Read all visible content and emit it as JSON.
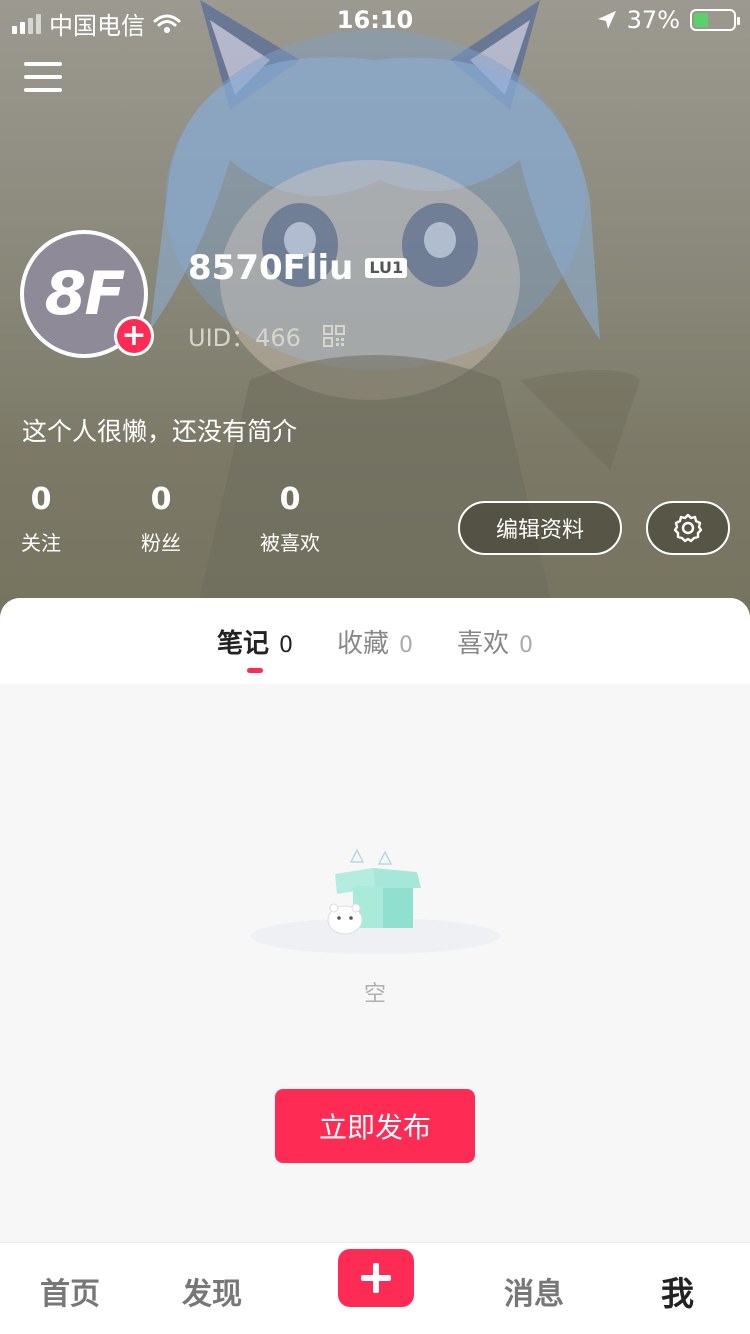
{
  "status_bar": {
    "carrier": "中国电信",
    "time": "16:10",
    "battery": "37%"
  },
  "profile": {
    "avatar_text": "8F",
    "username": "8570Fliu",
    "level": "LU1",
    "uid_label": "UID：",
    "uid_value": "466",
    "bio": "这个人很懒，还没有简介"
  },
  "stats": [
    {
      "value": "0",
      "label": "关注"
    },
    {
      "value": "0",
      "label": "粉丝"
    },
    {
      "value": "0",
      "label": "被喜欢"
    }
  ],
  "actions": {
    "edit_label": "编辑资料"
  },
  "tabs": [
    {
      "label": "笔记",
      "count": "0"
    },
    {
      "label": "收藏",
      "count": "0"
    },
    {
      "label": "喜欢",
      "count": "0"
    }
  ],
  "empty": {
    "text": "空",
    "publish_label": "立即发布"
  },
  "nav": {
    "home": "首页",
    "discover": "发现",
    "messages": "消息",
    "me": "我"
  },
  "colors": {
    "accent": "#fe2c55",
    "hero_bg": "#8d8b7e"
  }
}
